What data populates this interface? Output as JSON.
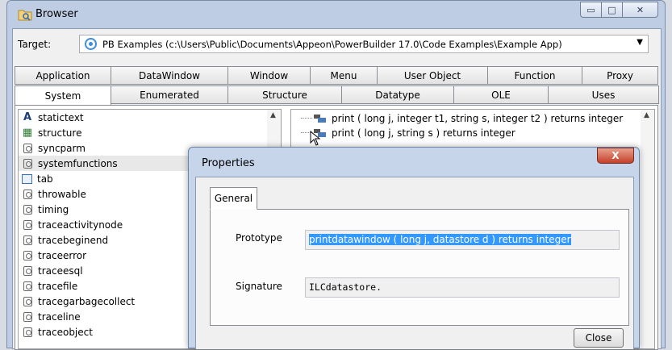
{
  "window": {
    "title": "Browser",
    "icon": "browser-folder-icon"
  },
  "target": {
    "label": "Target:",
    "value": "PB Examples (c:\\Users\\Public\\Documents\\Appeon\\PowerBuilder 17.0\\Code Examples\\Example App)"
  },
  "tabs_row1": [
    "Application",
    "DataWindow",
    "Window",
    "Menu",
    "User Object",
    "Function",
    "Proxy"
  ],
  "tabs_row2": [
    "System",
    "Enumerated",
    "Structure",
    "Datatype",
    "OLE",
    "Uses"
  ],
  "active_tab": "System",
  "system_list": [
    {
      "label": "statictext",
      "icon": "text-icon"
    },
    {
      "label": "structure",
      "icon": "structure-icon"
    },
    {
      "label": "syncparm",
      "icon": "object-icon"
    },
    {
      "label": "systemfunctions",
      "icon": "object-icon",
      "selected": true
    },
    {
      "label": "tab",
      "icon": "tab-icon"
    },
    {
      "label": "throwable",
      "icon": "object-icon"
    },
    {
      "label": "timing",
      "icon": "object-icon"
    },
    {
      "label": "traceactivitynode",
      "icon": "object-icon"
    },
    {
      "label": "tracebeginend",
      "icon": "object-icon"
    },
    {
      "label": "traceerror",
      "icon": "object-icon"
    },
    {
      "label": "traceesql",
      "icon": "object-icon"
    },
    {
      "label": "tracefile",
      "icon": "object-icon"
    },
    {
      "label": "tracegarbagecollect",
      "icon": "object-icon"
    },
    {
      "label": "traceline",
      "icon": "object-icon"
    },
    {
      "label": "traceobject",
      "icon": "object-icon"
    }
  ],
  "function_tree": [
    "print ( long j, integer t1, string s, integer t2 )  returns integer",
    "print ( long j, string s )  returns integer"
  ],
  "properties_dialog": {
    "title": "Properties",
    "close_glyph": "X",
    "tab": "General",
    "prototype_label": "Prototype",
    "prototype_value": "printdatawindow ( long j, datastore d )  returns integer",
    "signature_label": "Signature",
    "signature_value": "ILCdatastore.",
    "close_button": "Close"
  }
}
